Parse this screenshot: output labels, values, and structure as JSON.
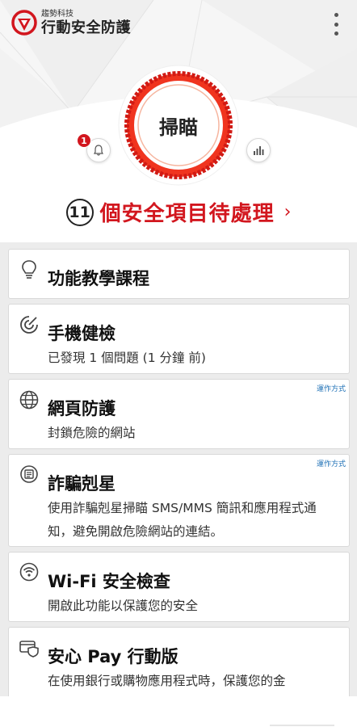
{
  "header": {
    "company": "趨勢科技",
    "product": "行動安全防護",
    "logo_icon": "trend-micro-logo",
    "menu_icon": "more-vert-icon"
  },
  "scan": {
    "label": "掃瞄",
    "notification_count": "1"
  },
  "status": {
    "count": "11",
    "text": "個安全項目待處理",
    "chevron": "›"
  },
  "features": [
    {
      "title": "功能教學課程",
      "icon": "lightbulb-icon"
    },
    {
      "title": "手機健檢",
      "description": "已發現 1 個問題 (1 分鐘 前)",
      "icon": "health-check-icon"
    },
    {
      "title": "網頁防護",
      "description": "封鎖危險的網站",
      "tag": "運作方式",
      "icon": "globe-icon"
    },
    {
      "title": "詐騙剋星",
      "description": "使用詐騙剋星掃瞄 SMS/MMS 簡訊和應用程式通知，避免開啟危險網站的連結。",
      "tag": "運作方式",
      "icon": "message-scan-icon"
    },
    {
      "title": "Wi-Fi 安全檢查",
      "description": "開啟此功能以保護您的安全",
      "icon": "wifi-shield-icon"
    },
    {
      "title": "安心 Pay 行動版",
      "description": "在使用銀行或購物應用程式時，保護您的金",
      "icon": "pay-guard-icon"
    }
  ],
  "colors": {
    "brand_red": "#d2161e",
    "link_blue": "#1c6fb5"
  }
}
